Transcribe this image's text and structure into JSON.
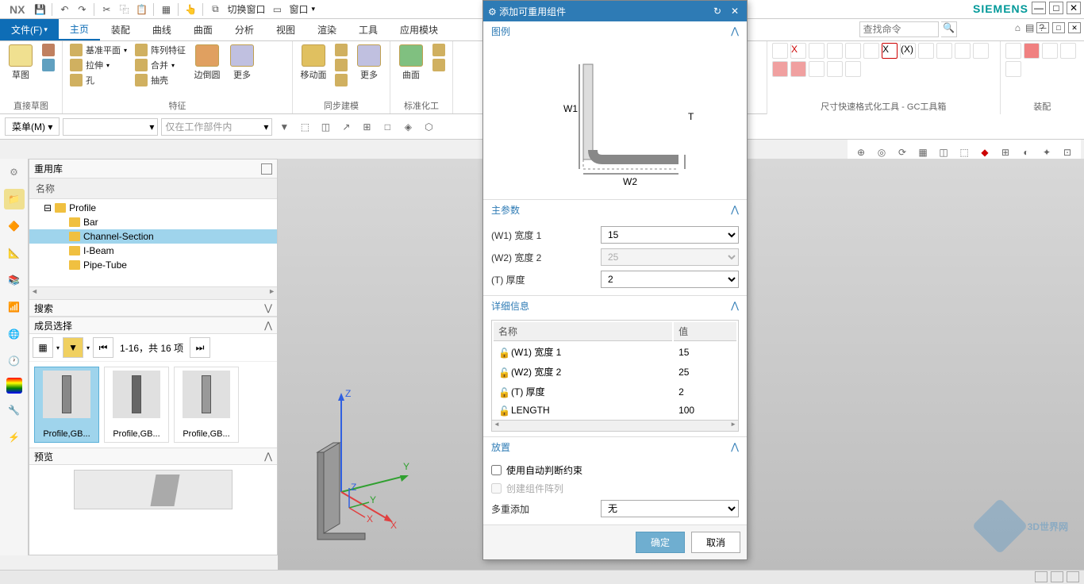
{
  "app": {
    "logo": "NX",
    "brand": "SIEMENS"
  },
  "topbar": {
    "switch_window": "切换窗口",
    "window": "窗口"
  },
  "tabs": {
    "file": "文件(F)",
    "items": [
      "主页",
      "装配",
      "曲线",
      "曲面",
      "分析",
      "视图",
      "渲染",
      "工具",
      "应用模块"
    ],
    "active": 0
  },
  "search": {
    "placeholder": "查找命令"
  },
  "ribbon": {
    "groups": [
      {
        "label": "直接草图",
        "big": [
          {
            "label": "草图"
          }
        ],
        "small": []
      },
      {
        "label": "特征",
        "big": [
          {
            "label": ""
          }
        ],
        "small": [
          [
            {
              "label": "基准平面"
            },
            {
              "label": "拉伸"
            },
            {
              "label": "孔"
            }
          ],
          [
            {
              "label": "阵列特征"
            },
            {
              "label": "合并"
            },
            {
              "label": "抽壳"
            }
          ]
        ],
        "extra": [
          {
            "label": "边倒圆"
          },
          {
            "label": "更多"
          }
        ]
      },
      {
        "label": "同步建模",
        "big": [
          {
            "label": "移动面"
          },
          {
            "label": "更多"
          }
        ],
        "small": []
      },
      {
        "label": "标准化工",
        "big": [
          {
            "label": "曲面"
          }
        ],
        "small": []
      }
    ],
    "right_group1": "尺寸快速格式化工具 - GC工具箱",
    "right_group2": "装配"
  },
  "menu_btn": "菜单(M)",
  "filter_placeholder": "仅在工作部件内",
  "reuse": {
    "title": "重用库",
    "name_col": "名称",
    "tree": {
      "root": "Profile",
      "children": [
        "Bar",
        "Channel-Section",
        "I-Beam",
        "Pipe-Tube"
      ],
      "selected": 1
    },
    "search_title": "搜索",
    "member_title": "成员选择",
    "pager": "1-16，共 16 项",
    "members": [
      "Profile,GB...",
      "Profile,GB...",
      "Profile,GB..."
    ],
    "preview_title": "预览"
  },
  "dialog": {
    "title": "添加可重用组件",
    "legend": "图例",
    "diagram": {
      "w1": "W1",
      "w2": "W2",
      "t": "T"
    },
    "main_params": "主参数",
    "params": [
      {
        "label": "(W1) 宽度 1",
        "value": "15",
        "enabled": true
      },
      {
        "label": "(W2) 宽度 2",
        "value": "25",
        "enabled": false
      },
      {
        "label": "(T) 厚度",
        "value": "2",
        "enabled": true
      }
    ],
    "detail": "详细信息",
    "detail_cols": [
      "名称",
      "值"
    ],
    "detail_rows": [
      {
        "name": "(W1) 宽度 1",
        "value": "15"
      },
      {
        "name": "(W2) 宽度 2",
        "value": "25"
      },
      {
        "name": "(T) 厚度",
        "value": "2"
      },
      {
        "name": "LENGTH",
        "value": "100"
      }
    ],
    "placement": "放置",
    "auto_constraint": "使用自动判断约束",
    "create_array": "创建组件阵列",
    "multi_add": "多重添加",
    "multi_add_value": "无",
    "ok": "确定",
    "cancel": "取消"
  },
  "watermark": "3D世界网"
}
